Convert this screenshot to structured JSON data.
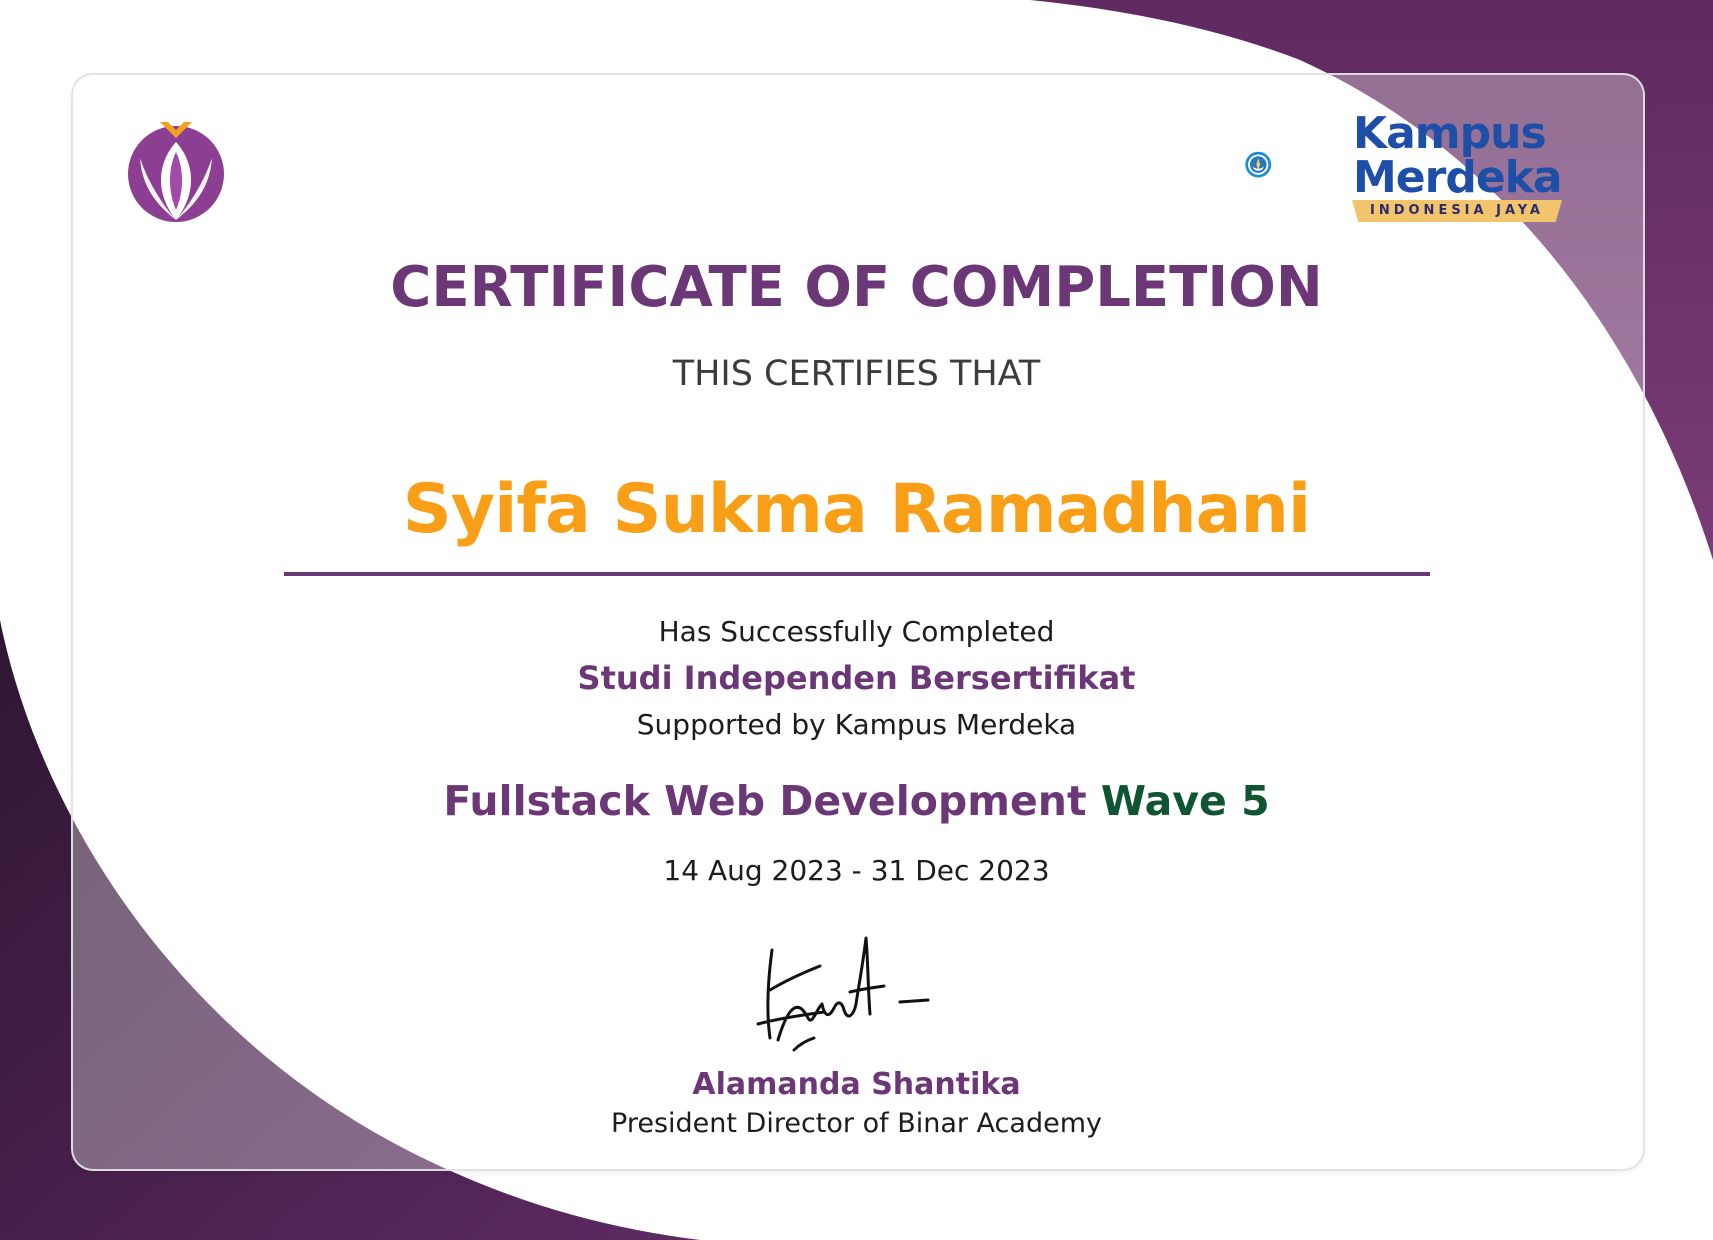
{
  "certificate": {
    "title": "CERTIFICATE OF COMPLETION",
    "subtitle": "THIS CERTIFIES THAT",
    "recipient_name": "Syifa Sukma Ramadhani",
    "completion_text": "Has Successfully Completed",
    "program_name": "Studi Independen Bersertifikat",
    "supported_by": "Supported by Kampus Merdeka",
    "course_name": "Fullstack Web Development",
    "wave": "Wave 5",
    "date_range": "14 Aug 2023 - 31 Dec 2023",
    "signer_name": "Alamanda Shantika",
    "signer_title": "President Director of Binar Academy"
  },
  "logos": {
    "left": "binar-academy-logo",
    "right_line1": "Kampus",
    "right_line2": "Merdeka",
    "right_tagline": "INDONESIA JAYA"
  },
  "colors": {
    "primary_purple": "#6b3776",
    "accent_orange": "#f89f17",
    "wave_green": "#0f5532",
    "dark_purple": "#3a1a3c",
    "kampus_blue": "#1d4fa8"
  }
}
